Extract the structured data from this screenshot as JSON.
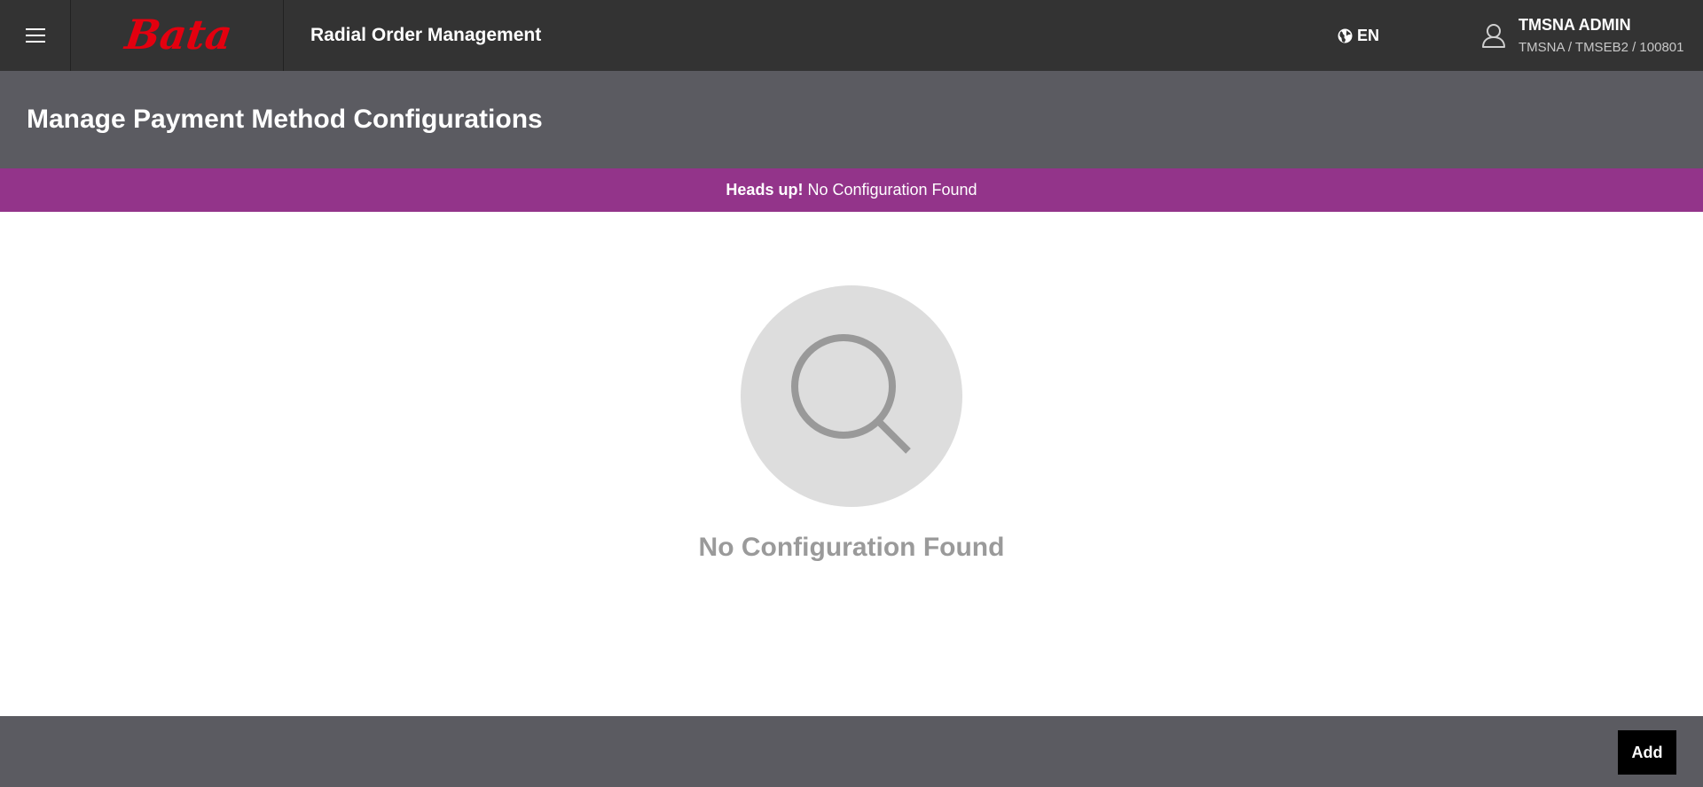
{
  "header": {
    "brand": "Bata",
    "app_title": "Radial Order Management",
    "language": "EN",
    "user": {
      "name": "TMSNA ADMIN",
      "org_path": "TMSNA / TMSEB2 / 100801"
    },
    "icons": {
      "menu": "hamburger-menu-icon",
      "language": "globe-icon",
      "user": "user-icon"
    }
  },
  "page": {
    "title": "Manage Payment Method Configurations"
  },
  "alert": {
    "prefix": "Heads up!",
    "message": "No Configuration Found",
    "color": "#93348a"
  },
  "empty_state": {
    "icon": "search-icon",
    "message": "No Configuration Found"
  },
  "footer": {
    "add_label": "Add"
  },
  "colors": {
    "topbar": "#333333",
    "header": "#5b5b61",
    "brand_red": "#e3000f"
  }
}
